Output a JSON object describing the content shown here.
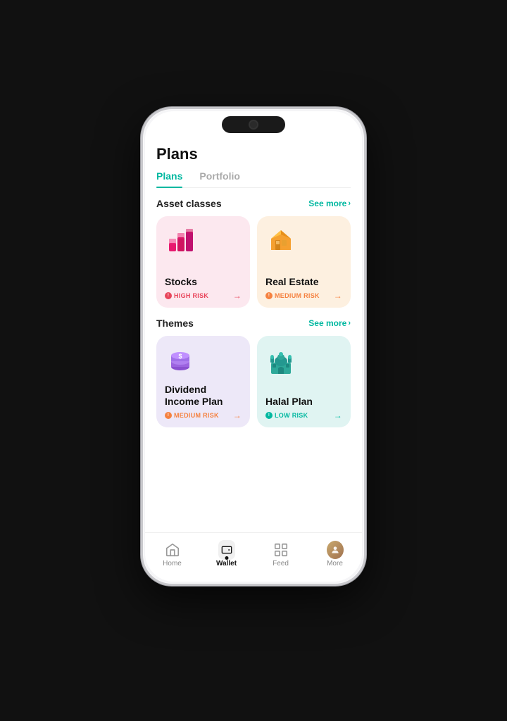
{
  "page": {
    "title": "Plans"
  },
  "tabs": [
    {
      "id": "plans",
      "label": "Plans",
      "active": true
    },
    {
      "id": "portfolio",
      "label": "Portfolio",
      "active": false
    }
  ],
  "asset_classes": {
    "section_title": "Asset classes",
    "see_more_label": "See more",
    "cards": [
      {
        "id": "stocks",
        "title": "Stocks",
        "risk_label": "HIGH RISK",
        "risk_level": "high",
        "bg": "#fce8ef"
      },
      {
        "id": "realestate",
        "title": "Real Estate",
        "risk_label": "MEDIUM RISK",
        "risk_level": "medium",
        "bg": "#fdf0e0"
      }
    ]
  },
  "themes": {
    "section_title": "Themes",
    "see_more_label": "See more",
    "cards": [
      {
        "id": "dividend",
        "title": "Dividend Income Plan",
        "risk_label": "MEDIUM RISK",
        "risk_level": "medium",
        "bg": "#ede8f8"
      },
      {
        "id": "halal",
        "title": "Halal Plan",
        "risk_label": "LOW RISK",
        "risk_level": "low",
        "bg": "#e0f4f2"
      }
    ]
  },
  "bottom_nav": {
    "items": [
      {
        "id": "home",
        "label": "Home",
        "active": false
      },
      {
        "id": "wallet",
        "label": "Wallet",
        "active": true
      },
      {
        "id": "feed",
        "label": "Feed",
        "active": false
      },
      {
        "id": "more",
        "label": "More",
        "active": false
      }
    ]
  },
  "colors": {
    "accent": "#00b8a0",
    "high_risk": "#e8445a",
    "medium_risk": "#f5813f",
    "low_risk": "#00b8a0"
  }
}
